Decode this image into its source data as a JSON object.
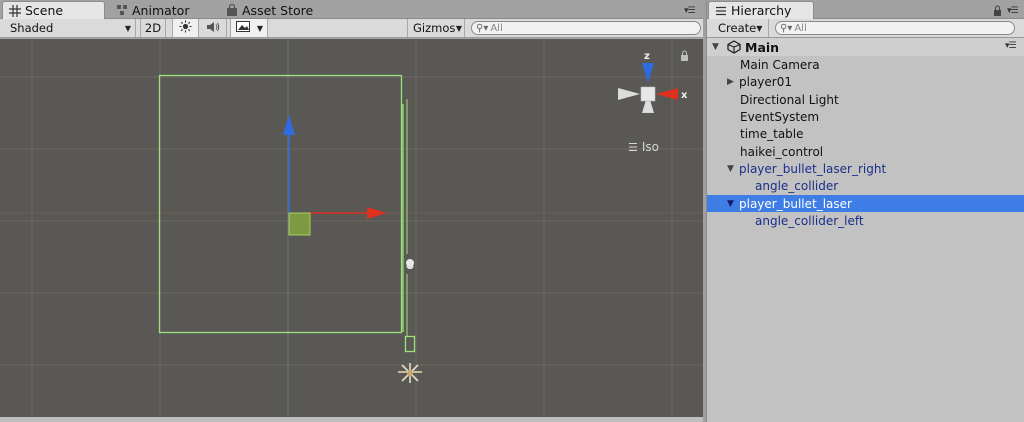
{
  "scene_tabs": {
    "scene": "Scene",
    "animator": "Animator",
    "asset_store": "Asset Store"
  },
  "scene_toolbar": {
    "shading_mode": "Shaded",
    "mode_2d": "2D",
    "gizmos": "Gizmos",
    "search_placeholder": "All"
  },
  "gizmo": {
    "axis_z": "z",
    "axis_x": "x",
    "projection": "Iso"
  },
  "hierarchy": {
    "tab": "Hierarchy",
    "create": "Create",
    "search_placeholder": "All",
    "scene_name": "Main",
    "items": [
      {
        "label": "Main Camera"
      },
      {
        "label": "player01"
      },
      {
        "label": "Directional Light"
      },
      {
        "label": "EventSystem"
      },
      {
        "label": "time_table"
      },
      {
        "label": "haikei_control"
      },
      {
        "label": "player_bullet_laser_right"
      },
      {
        "label": "angle_collider"
      },
      {
        "label": "player_bullet_laser"
      },
      {
        "label": "angle_collider_left"
      }
    ]
  },
  "colors": {
    "viewport_bg": "#5a5854",
    "selection_green": "#9be07a",
    "axis_red": "#e0301e",
    "axis_blue": "#2f6be0",
    "hierarchy_selected": "#3e7de6",
    "prefab_text": "#1a2f8a"
  }
}
